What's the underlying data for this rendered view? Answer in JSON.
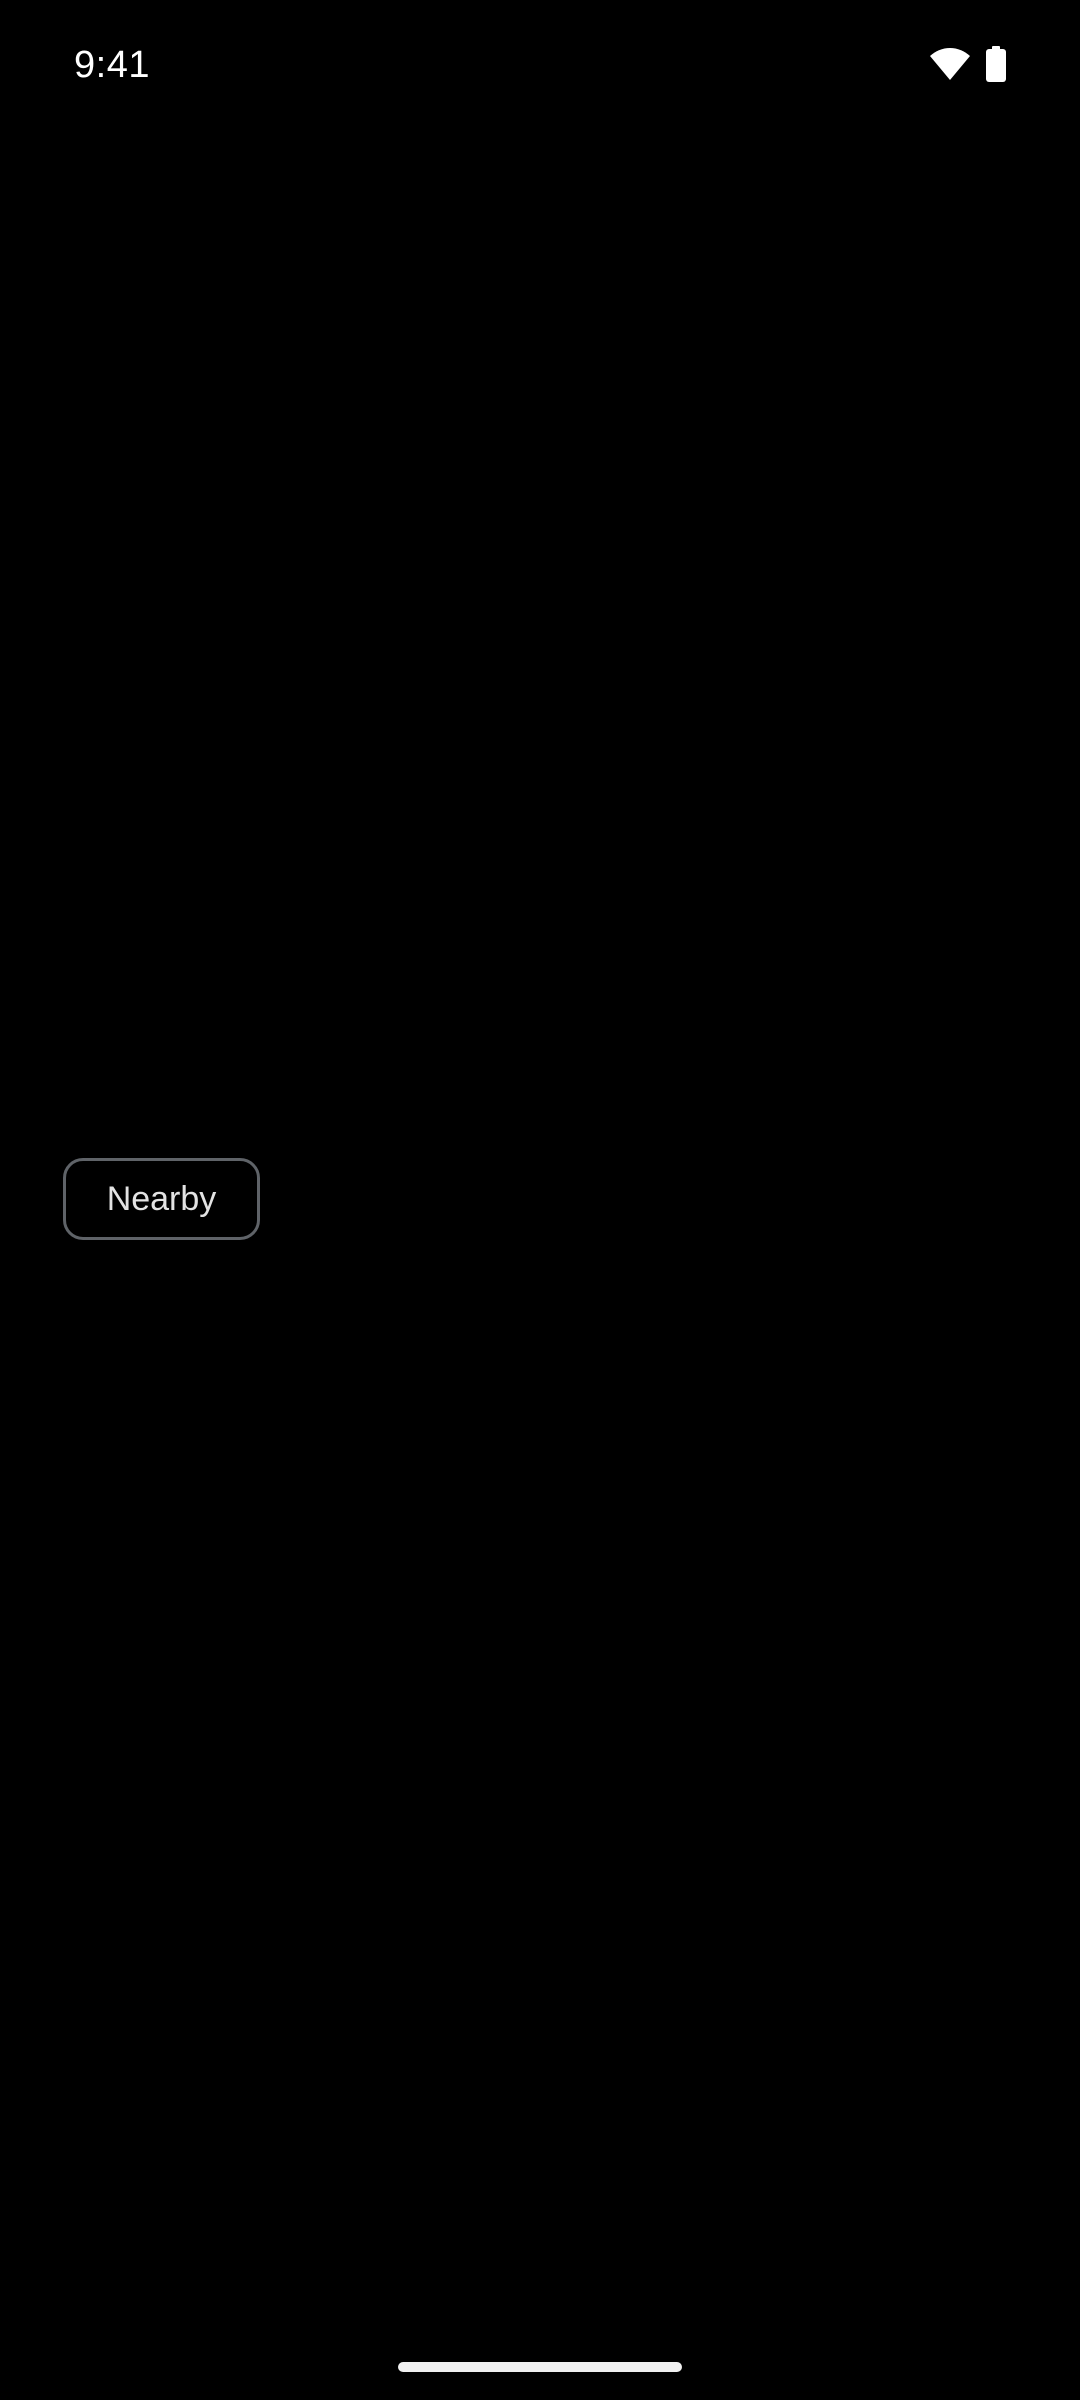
{
  "status_bar": {
    "time": "9:41",
    "icons": [
      "wifi-icon",
      "battery-icon"
    ]
  },
  "chips": {
    "nearby_label": "Nearby"
  },
  "colors": {
    "background": "#000000",
    "text": "#ffffff",
    "chip_border": "#5f6368",
    "chip_text": "#e3e3e3"
  }
}
